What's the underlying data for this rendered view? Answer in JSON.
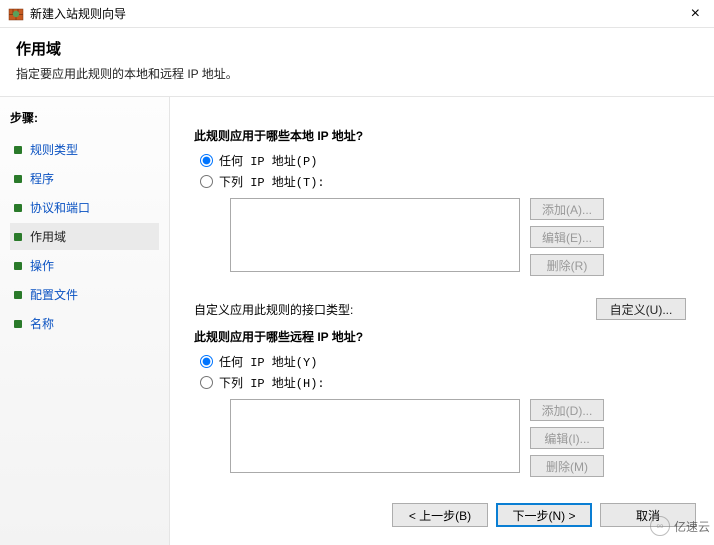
{
  "titlebar": {
    "title": "新建入站规则向导"
  },
  "header": {
    "title": "作用域",
    "subtitle": "指定要应用此规则的本地和远程 IP 地址。"
  },
  "sidebar": {
    "steps_label": "步骤:",
    "items": [
      {
        "label": "规则类型"
      },
      {
        "label": "程序"
      },
      {
        "label": "协议和端口"
      },
      {
        "label": "作用域"
      },
      {
        "label": "操作"
      },
      {
        "label": "配置文件"
      },
      {
        "label": "名称"
      }
    ],
    "active_index": 3
  },
  "content": {
    "local_section_title": "此规则应用于哪些本地 IP 地址?",
    "local_radio_any": "任何 IP 地址(P)",
    "local_radio_these": "下列 IP 地址(T):",
    "interface_label": "自定义应用此规则的接口类型:",
    "interface_button": "自定义(U)...",
    "remote_section_title": "此规则应用于哪些远程 IP 地址?",
    "remote_radio_any": "任何 IP 地址(Y)",
    "remote_radio_these": "下列 IP 地址(H):",
    "buttons_local": {
      "add": "添加(A)...",
      "edit": "编辑(E)...",
      "remove": "删除(R)"
    },
    "buttons_remote": {
      "add": "添加(D)...",
      "edit": "编辑(I)...",
      "remove": "删除(M)"
    }
  },
  "footer": {
    "back": "< 上一步(B)",
    "next": "下一步(N) >",
    "cancel": "取消"
  },
  "watermark": "亿速云"
}
